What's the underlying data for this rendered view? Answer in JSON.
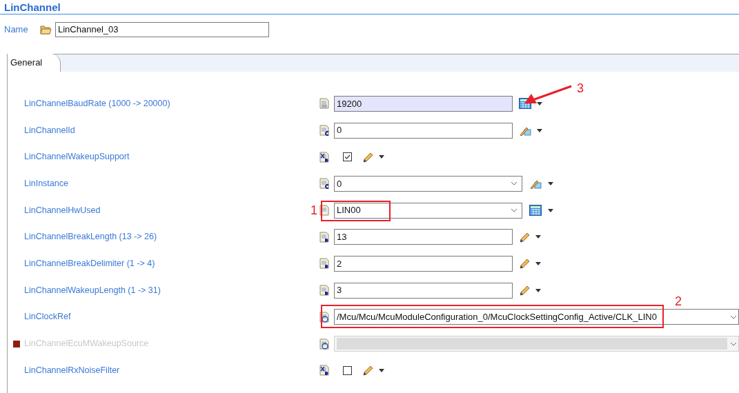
{
  "title": "LinChannel",
  "name": {
    "label": "Name",
    "value": "LinChannel_03"
  },
  "tabs": [
    {
      "label": "General",
      "selected": true
    }
  ],
  "rows": [
    {
      "label": "LinChannelBaudRate (1000 -> 20000)",
      "kind": "text",
      "value": "19200",
      "type_icon": {
        "kind": "number"
      },
      "action": {
        "kind": "calculator"
      },
      "highlighted": true
    },
    {
      "label": "LinChannelId",
      "kind": "text",
      "value": "0",
      "type_icon": {
        "kind": "calc"
      },
      "action": {
        "kind": "wand"
      },
      "highlighted": false
    },
    {
      "label": "LinChannelWakeupSupport",
      "kind": "checkbox",
      "checked": true,
      "type_icon": {
        "kind": "bool"
      },
      "action": {
        "kind": "pencil"
      }
    },
    {
      "label": "LinInstance",
      "kind": "combo",
      "value": "0",
      "type_icon": {
        "kind": "calc"
      },
      "action": {
        "kind": "wand"
      }
    },
    {
      "label": "LinChannelHwUsed",
      "kind": "combo",
      "value": "LIN00",
      "type_icon": {
        "kind": "plain"
      },
      "action": {
        "kind": "calculator"
      }
    },
    {
      "label": "LinChannelBreakLength (13 -> 26)",
      "kind": "text",
      "value": "13",
      "type_icon": {
        "kind": "default"
      },
      "action": {
        "kind": "pencil"
      },
      "highlighted": false
    },
    {
      "label": "LinChannelBreakDelimiter (1 -> 4)",
      "kind": "text",
      "value": "2",
      "type_icon": {
        "kind": "default"
      },
      "action": {
        "kind": "pencil"
      },
      "highlighted": false
    },
    {
      "label": "LinChannelWakeupLength (1 -> 31)",
      "kind": "text",
      "value": "3",
      "type_icon": {
        "kind": "default"
      },
      "action": {
        "kind": "pencil"
      },
      "highlighted": false
    },
    {
      "label": "LinClockRef",
      "kind": "reference",
      "value": "/Mcu/Mcu/McuModuleConfiguration_0/McuClockSettingConfig_Active/CLK_LIN0",
      "type_icon": {
        "kind": "ref"
      },
      "disabled": false
    },
    {
      "label": "LinChannelEcuMWakeupSource",
      "kind": "reference",
      "type_icon": {
        "kind": "ref"
      },
      "disabled": true,
      "error": true
    },
    {
      "label": "LinChannelRxNoiseFilter",
      "kind": "checkbox",
      "checked": false,
      "type_icon": {
        "kind": "bool"
      },
      "action": {
        "kind": "pencil"
      }
    }
  ],
  "annotations": [
    {
      "label": "1"
    },
    {
      "label": "2"
    },
    {
      "label": "3"
    }
  ]
}
